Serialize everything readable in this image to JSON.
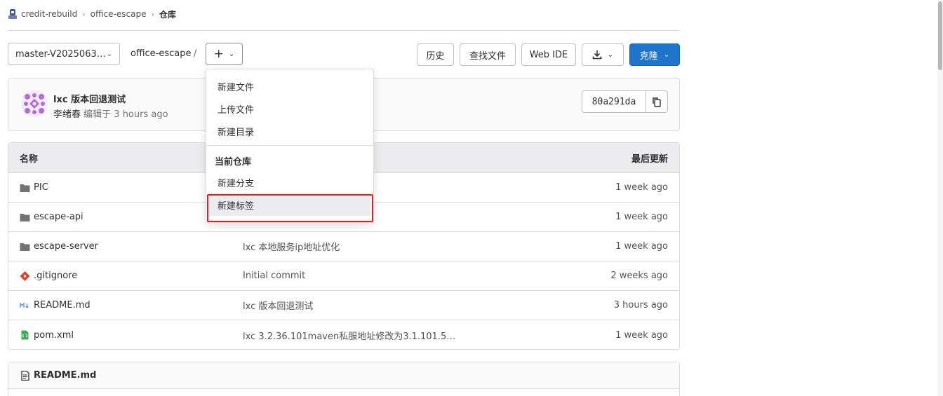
{
  "breadcrumb": {
    "group": "credit-rebuild",
    "project": "office-escape",
    "current": "仓库"
  },
  "toolbar": {
    "branch": "master-V2025063…",
    "path": "office-escape",
    "path_sep": "/",
    "history": "历史",
    "find_file": "查找文件",
    "web_ide": "Web IDE",
    "clone": "克隆"
  },
  "commit": {
    "title": "lxc 版本回退测试",
    "author": "李绪春",
    "edited_text": "编辑于 3 hours ago",
    "sha": "80a291da"
  },
  "table": {
    "col_name": "名称",
    "col_updated": "最后更新",
    "rows": [
      {
        "name": "PIC",
        "message": "",
        "date": "1 week ago"
      },
      {
        "name": "escape-api",
        "message": "",
        "date": "1 week ago"
      },
      {
        "name": "escape-server",
        "message": "lxc 本地服务ip地址优化",
        "date": "1 week ago"
      },
      {
        "name": ".gitignore",
        "message": "Initial commit",
        "date": "2 weeks ago"
      },
      {
        "name": "README.md",
        "message": "lxc 版本回退测试",
        "date": "3 hours ago"
      },
      {
        "name": "pom.xml",
        "message": "lxc 3.2.36.101maven私服地址修改为3.1.101.5…",
        "date": "1 week ago"
      }
    ]
  },
  "readme": {
    "title": "README.md"
  },
  "dropdown": {
    "new_file": "新建文件",
    "upload_file": "上传文件",
    "new_directory": "新建目录",
    "section_title": "当前仓库",
    "new_branch": "新建分支",
    "new_tag": "新建标签"
  },
  "colors": {
    "primary": "#1f75cb",
    "highlight_outline": "#e02020",
    "git_icon": "#e24329",
    "md_icon": "#6b9bd1",
    "xml_icon": "#3fae58"
  }
}
